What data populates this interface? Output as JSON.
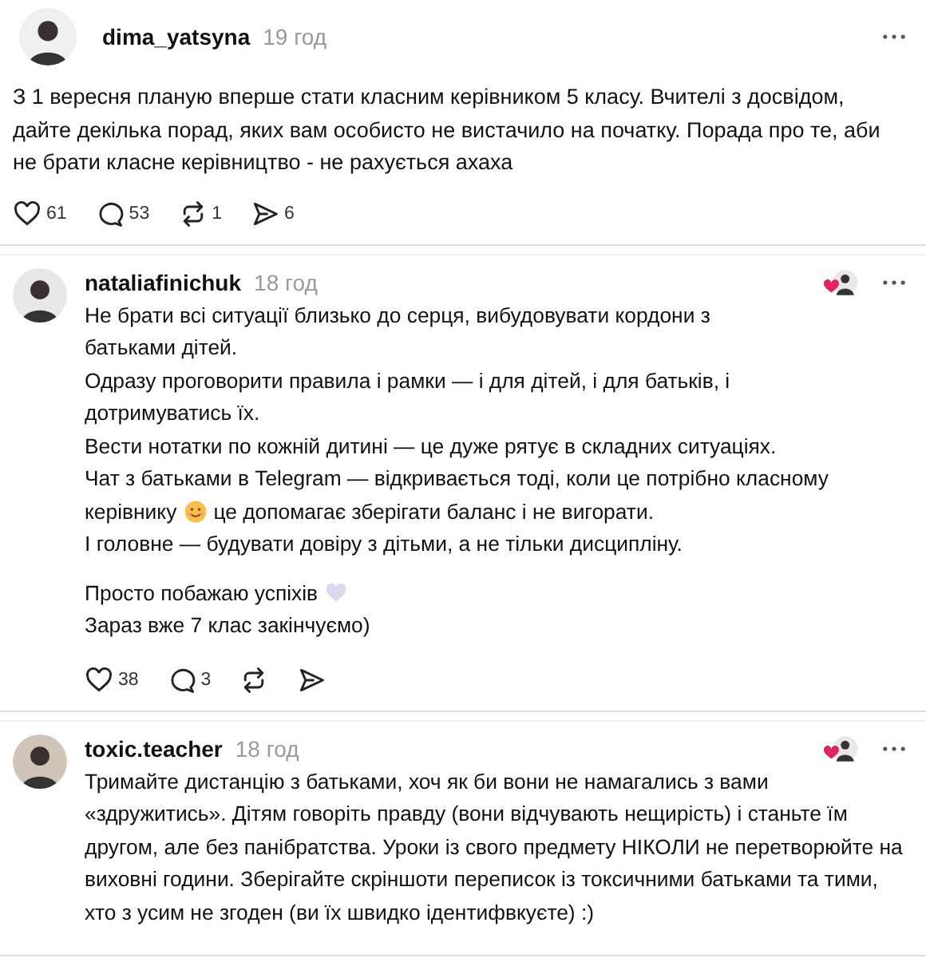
{
  "post": {
    "username": "dima_yatsyna",
    "time": "19 год",
    "text": "З 1 вересня планую вперше стати класним керівником 5 класу. Вчителі з досвідом, дайте декілька порад, яких вам особисто не вистачило на початку. Порада про те, аби не брати класне керівництво - не рахується ахаха",
    "actions": [
      {
        "kind": "like",
        "count": "61"
      },
      {
        "kind": "reply",
        "count": "53"
      },
      {
        "kind": "repost",
        "count": "1"
      },
      {
        "kind": "share",
        "count": "6"
      }
    ]
  },
  "replies": [
    {
      "username": "nataliafinichuk",
      "time": "18 год",
      "liked_by_author": true,
      "paragraphs": [
        [
          [
            {
              "kind": "text",
              "text": "Не брати всі ситуації близько до серця, вибудовувати кордони з"
            }
          ],
          [
            {
              "kind": "text",
              "text": "батьками дітей."
            }
          ],
          [
            {
              "kind": "text",
              "text": "Одразу проговорити правила і рамки — і для дітей, і для батьків, і"
            }
          ],
          [
            {
              "kind": "text",
              "text": "дотримуватись їх."
            }
          ],
          [
            {
              "kind": "text",
              "text": "Вести нотатки по кожній дитині — це дуже рятує в складних ситуаціях."
            }
          ],
          [
            {
              "kind": "text",
              "text": "Чат з батьками в Telegram — відкривається тоді, коли це потрібно класному"
            }
          ],
          [
            {
              "kind": "text",
              "text": "керівнику"
            },
            {
              "kind": "smile"
            },
            {
              "kind": "text",
              "text": "це допомагає зберігати баланс і не вигорати."
            }
          ],
          [
            {
              "kind": "text",
              "text": "І головне — будувати довіру з дітьми, а не тільки дисципліну."
            }
          ]
        ],
        [
          [
            {
              "kind": "text",
              "text": "Просто побажаю успіхів"
            },
            {
              "kind": "heart"
            }
          ],
          [
            {
              "kind": "text",
              "text": "Зараз вже 7 клас закінчуємо)"
            }
          ]
        ]
      ],
      "actions": [
        {
          "kind": "like",
          "count": "38"
        },
        {
          "kind": "reply",
          "count": "3"
        },
        {
          "kind": "repost"
        },
        {
          "kind": "share"
        }
      ]
    },
    {
      "username": "toxic.teacher",
      "time": "18 год",
      "liked_by_author": true,
      "paragraphs": [
        [
          [
            {
              "kind": "text",
              "text": "Тримайте дистанцію з батьками, хоч як би вони не намагались з вами «здружитись». Дітям говоріть правду (вони відчувають нещирість) і станьте їм другом, але без панібратства. Уроки із свого предмету НІКОЛИ не перетворюйте на виховні години. Зберігайте скріншоти переписок із токсичними батьками та тими, хто з усим не згоден (ви їх швидко ідентифвкуєте) :)"
            }
          ]
        ]
      ]
    }
  ]
}
